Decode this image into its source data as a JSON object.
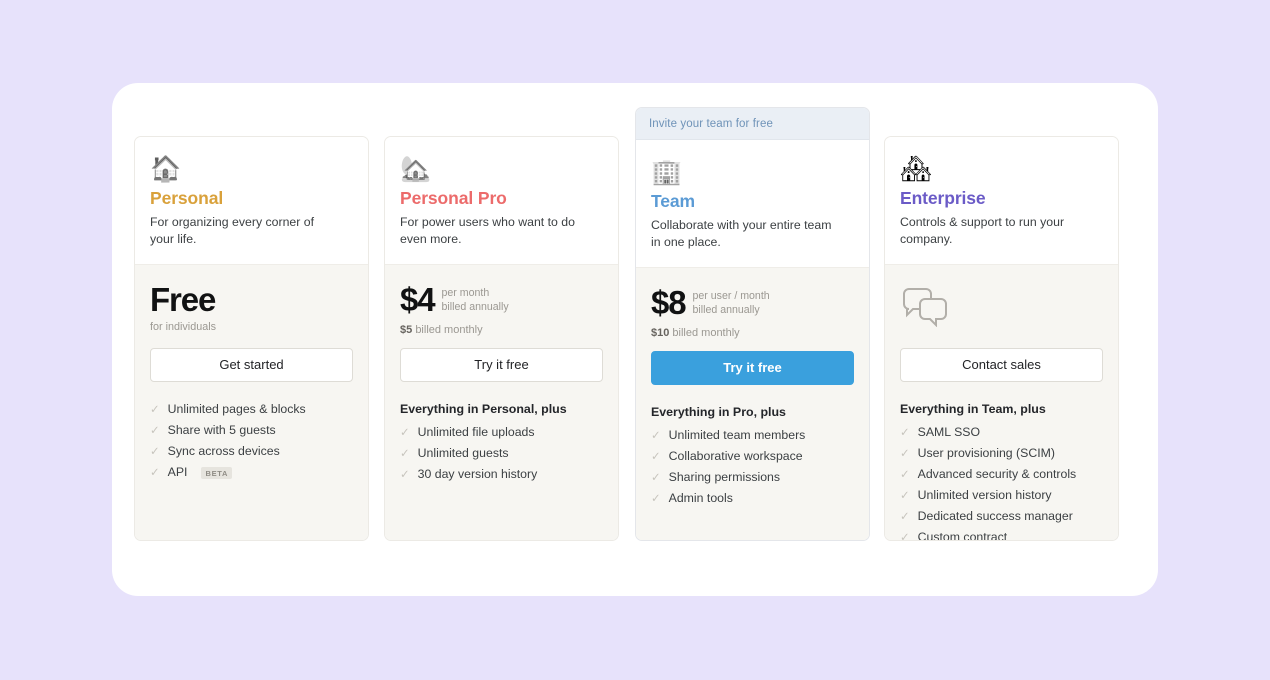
{
  "theme": {
    "page_background": "#e7e2fb",
    "panel_background": "#ffffff",
    "card_body_background": "#f7f6f2",
    "featured_banner_background": "#eaeff5",
    "featured_accent": "#3aa0dd"
  },
  "plans": [
    {
      "id": "personal",
      "icon": "house-icon",
      "emoji": "🏠",
      "name": "Personal",
      "name_color": "#d9a13b",
      "tagline": "For organizing every corner of your life.",
      "price_amount": "Free",
      "price_unit": "",
      "price_billing": "",
      "price_sub": "for individuals",
      "price_note_strong": "",
      "price_note_rest": "",
      "cta_label": "Get started",
      "cta_style": "outline",
      "features_heading": "",
      "features": [
        {
          "label": "Unlimited pages & blocks",
          "badge": ""
        },
        {
          "label": "Share with 5 guests",
          "badge": ""
        },
        {
          "label": "Sync across devices",
          "badge": ""
        },
        {
          "label": "API",
          "badge": "BETA"
        }
      ]
    },
    {
      "id": "personal-pro",
      "icon": "house-with-garden-icon",
      "emoji": "🏡",
      "name": "Personal Pro",
      "name_color": "#ec6b6b",
      "tagline": "For power users who want to do even more.",
      "price_amount": "$4",
      "price_unit": "per month",
      "price_billing": "billed annually",
      "price_sub": "",
      "price_note_strong": "$5",
      "price_note_rest": "billed monthly",
      "cta_label": "Try it free",
      "cta_style": "outline",
      "features_heading": "Everything in Personal, plus",
      "features": [
        {
          "label": "Unlimited file uploads",
          "badge": ""
        },
        {
          "label": "Unlimited guests",
          "badge": ""
        },
        {
          "label": "30 day version history",
          "badge": ""
        }
      ]
    },
    {
      "id": "team",
      "icon": "office-building-icon",
      "emoji": "🏢",
      "banner_label": "Invite your team for free",
      "name": "Team",
      "name_color": "#5b9bd5",
      "tagline": "Collaborate with your entire team in one place.",
      "price_amount": "$8",
      "price_unit": "per user / month",
      "price_billing": "billed annually",
      "price_sub": "",
      "price_note_strong": "$10",
      "price_note_rest": "billed monthly",
      "cta_label": "Try it free",
      "cta_style": "primary",
      "features_heading": "Everything in Pro, plus",
      "features": [
        {
          "label": "Unlimited team members",
          "badge": ""
        },
        {
          "label": "Collaborative workspace",
          "badge": ""
        },
        {
          "label": "Sharing permissions",
          "badge": ""
        },
        {
          "label": "Admin tools",
          "badge": ""
        }
      ]
    },
    {
      "id": "enterprise",
      "icon": "cityscape-icon",
      "emoji": "🏘",
      "name": "Enterprise",
      "name_color": "#6b5bc7",
      "tagline": "Controls & support to run your company.",
      "price_amount": "",
      "price_unit": "",
      "price_billing": "",
      "price_sub": "",
      "price_note_strong": "",
      "price_note_rest": "",
      "cta_label": "Contact sales",
      "cta_style": "outline",
      "features_heading": "Everything in Team, plus",
      "features": [
        {
          "label": "SAML SSO",
          "badge": ""
        },
        {
          "label": "User provisioning (SCIM)",
          "badge": ""
        },
        {
          "label": "Advanced security & controls",
          "badge": ""
        },
        {
          "label": "Unlimited version history",
          "badge": ""
        },
        {
          "label": "Dedicated success manager",
          "badge": ""
        },
        {
          "label": "Custom contract",
          "badge": ""
        }
      ]
    }
  ],
  "check_glyph": "✓"
}
